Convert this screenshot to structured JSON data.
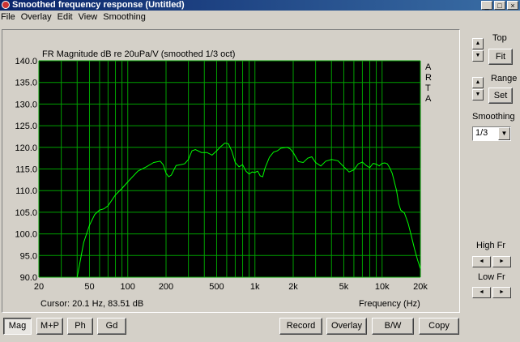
{
  "window": {
    "title": "Smoothed frequency response (Untitled)"
  },
  "menu": [
    "File",
    "Overlay",
    "Edit",
    "View",
    "Smoothing"
  ],
  "plot": {
    "title": "FR Magnitude dB re 20uPa/V (smoothed 1/3 oct)",
    "watermark": [
      "A",
      "R",
      "T",
      "A"
    ],
    "cursor": "Cursor: 20.1 Hz, 83.51 dB",
    "xlabel": "Frequency (Hz)"
  },
  "chart_data": {
    "type": "line",
    "title": "FR Magnitude dB re 20uPa/V (smoothed 1/3 oct)",
    "xlabel": "Frequency (Hz)",
    "ylabel": "",
    "xscale": "log",
    "xlim": [
      20,
      20000
    ],
    "ylim": [
      90,
      140
    ],
    "x_ticks": [
      20,
      50,
      100,
      200,
      500,
      1000,
      2000,
      5000,
      10000,
      20000
    ],
    "x_tick_labels": [
      "20",
      "50",
      "100",
      "200",
      "500",
      "1k",
      "2k",
      "5k",
      "10k",
      "20k"
    ],
    "y_ticks": [
      90,
      95,
      100,
      105,
      110,
      115,
      120,
      125,
      130,
      135,
      140
    ],
    "y_tick_labels": [
      "90.0",
      "95.0",
      "100.0",
      "105.0",
      "110.0",
      "115.0",
      "120.0",
      "125.0",
      "130.0",
      "135.0",
      "140.0"
    ],
    "background": "#000000",
    "grid_color": "#00a000",
    "line_color": "#00ff00",
    "series": [
      {
        "x": [
          40,
          45,
          50,
          55,
          60,
          65,
          70,
          80,
          90,
          100,
          120,
          140,
          160,
          180,
          190,
          200,
          210,
          220,
          240,
          260,
          280,
          300,
          320,
          340,
          380,
          420,
          460,
          500,
          540,
          580,
          620,
          660,
          700,
          750,
          800,
          850,
          900,
          950,
          1000,
          1050,
          1100,
          1150,
          1200,
          1300,
          1400,
          1500,
          1600,
          1700,
          1800,
          1900,
          2000,
          2200,
          2400,
          2600,
          2800,
          3000,
          3300,
          3600,
          4000,
          4500,
          5000,
          5500,
          6000,
          6500,
          7000,
          7500,
          8000,
          8500,
          9000,
          9500,
          10000,
          10500,
          11000,
          11500,
          12000,
          13000,
          13500,
          14000,
          15000,
          16000,
          17000,
          18000,
          19000,
          20000
        ],
        "y": [
          90,
          98,
          102,
          104.5,
          105.5,
          105.8,
          106.5,
          109,
          110.5,
          112,
          114.5,
          115.5,
          116.5,
          116.8,
          116,
          114,
          113.2,
          113.6,
          115.8,
          116,
          116.2,
          117.2,
          119.2,
          119.5,
          118.8,
          118.8,
          118.2,
          119.2,
          120.2,
          121,
          120.8,
          119,
          116.5,
          115.5,
          116,
          114.5,
          113.8,
          114.3,
          114.2,
          114.5,
          113.4,
          113.2,
          115.2,
          117.7,
          118.9,
          119.2,
          119.8,
          119.9,
          120,
          119.6,
          118.8,
          116.7,
          116.5,
          117.5,
          117.8,
          116.5,
          115.7,
          116.8,
          117.2,
          116.9,
          115.5,
          114.3,
          114.8,
          116.2,
          116.6,
          115.8,
          115.3,
          116.3,
          116.1,
          115.7,
          116.3,
          116.4,
          116.2,
          115.2,
          114,
          110,
          107,
          105.5,
          104.8,
          102.5,
          99.5,
          96.5,
          94,
          92
        ]
      }
    ]
  },
  "controls": {
    "top_label": "Top",
    "fit_label": "Fit",
    "range_label": "Range",
    "set_label": "Set",
    "smoothing_label": "Smoothing",
    "smoothing_value": "1/3",
    "high_fr_label": "High Fr",
    "low_fr_label": "Low Fr"
  },
  "bottom_buttons": {
    "mag": "Mag",
    "mp": "M+P",
    "ph": "Ph",
    "gd": "Gd",
    "record": "Record",
    "overlay": "Overlay",
    "bw": "B/W",
    "copy": "Copy"
  }
}
